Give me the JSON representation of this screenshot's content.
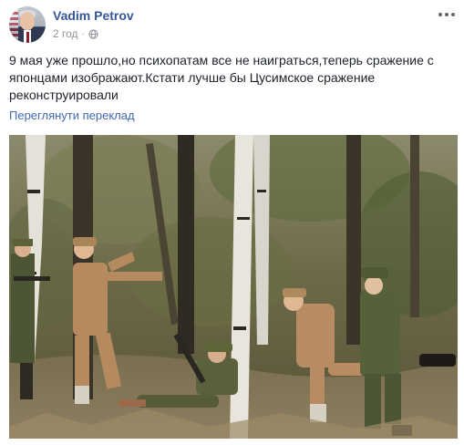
{
  "post": {
    "author": "Vadim Petrov",
    "time": "2 год",
    "dot": "·",
    "text": "9 мая уже прошло,но психопатам все не наиграться,теперь сражение с японцами изображают.Кстати лучше бы Цусимское сражение реконструировали",
    "translate_link": "Переглянути переклад"
  },
  "icons": {
    "avatar": "profile-photo",
    "privacy": "globe-icon",
    "options": "more-options-icon"
  },
  "photo": {
    "subject": "war reenactment in birch forest"
  },
  "colors": {
    "author_link": "#365899",
    "translate_link": "#4267b2",
    "meta_text": "#90949c",
    "body_text": "#1d2129"
  }
}
